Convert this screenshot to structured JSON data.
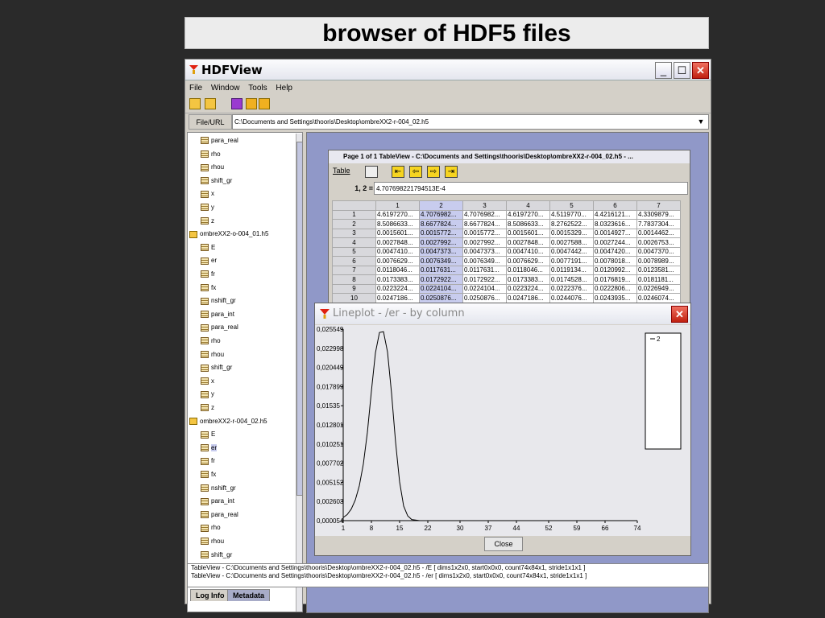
{
  "slide": {
    "title": "browser of HDF5 files"
  },
  "app": {
    "title": "HDFView",
    "menu": [
      "File",
      "Window",
      "Tools",
      "Help"
    ],
    "url_label": "File/URL",
    "url_value": "C:\\Documents and Settings\\thooris\\Desktop\\ombreXX2-r-004_02.h5"
  },
  "tree": [
    {
      "label": "para_real",
      "type": "dataset"
    },
    {
      "label": "rho",
      "type": "dataset"
    },
    {
      "label": "rhou",
      "type": "dataset"
    },
    {
      "label": "shift_gr",
      "type": "dataset"
    },
    {
      "label": "x",
      "type": "dataset"
    },
    {
      "label": "y",
      "type": "dataset"
    },
    {
      "label": "z",
      "type": "dataset"
    },
    {
      "label": "ombreXX2-o-004_01.h5",
      "type": "file"
    },
    {
      "label": "E",
      "type": "dataset"
    },
    {
      "label": "er",
      "type": "dataset"
    },
    {
      "label": "fr",
      "type": "dataset"
    },
    {
      "label": "fx",
      "type": "dataset"
    },
    {
      "label": "nshift_gr",
      "type": "dataset"
    },
    {
      "label": "para_int",
      "type": "dataset"
    },
    {
      "label": "para_real",
      "type": "dataset"
    },
    {
      "label": "rho",
      "type": "dataset"
    },
    {
      "label": "rhou",
      "type": "dataset"
    },
    {
      "label": "shift_gr",
      "type": "dataset"
    },
    {
      "label": "x",
      "type": "dataset"
    },
    {
      "label": "y",
      "type": "dataset"
    },
    {
      "label": "z",
      "type": "dataset"
    },
    {
      "label": "ombreXX2-r-004_02.h5",
      "type": "file"
    },
    {
      "label": "E",
      "type": "dataset"
    },
    {
      "label": "er",
      "type": "dataset",
      "selected": true
    },
    {
      "label": "fr",
      "type": "dataset"
    },
    {
      "label": "fx",
      "type": "dataset"
    },
    {
      "label": "nshift_gr",
      "type": "dataset"
    },
    {
      "label": "para_int",
      "type": "dataset"
    },
    {
      "label": "para_real",
      "type": "dataset"
    },
    {
      "label": "rho",
      "type": "dataset"
    },
    {
      "label": "rhou",
      "type": "dataset"
    },
    {
      "label": "shift_gr",
      "type": "dataset"
    }
  ],
  "tableview": {
    "title": "Page 1 of 1   TableView - C:\\Documents and Settings\\thooris\\Desktop\\ombreXX2-r-004_02.h5 - ...",
    "menu_label": "Table",
    "cell_ref": "1, 2 =",
    "cell_value": "4.707698221794513E-4",
    "columns": [
      "1",
      "2",
      "3",
      "4",
      "5",
      "6",
      "7"
    ],
    "rows": [
      {
        "id": "1",
        "cells": [
          "4.6197270...",
          "4.7076982...",
          "4.7076982...",
          "4.6197270...",
          "4.5119770...",
          "4.4216121...",
          "4.3309879..."
        ]
      },
      {
        "id": "2",
        "cells": [
          "8.5086633...",
          "8.6677824...",
          "8.6677824...",
          "8.5086633...",
          "8.2762522...",
          "8.0323616...",
          "7.7837304..."
        ]
      },
      {
        "id": "3",
        "cells": [
          "0.0015601...",
          "0.0015772...",
          "0.0015772...",
          "0.0015601...",
          "0.0015329...",
          "0.0014927...",
          "0.0014462..."
        ]
      },
      {
        "id": "4",
        "cells": [
          "0.0027848...",
          "0.0027992...",
          "0.0027992...",
          "0.0027848...",
          "0.0027588...",
          "0.0027244...",
          "0.0026753..."
        ]
      },
      {
        "id": "5",
        "cells": [
          "0.0047410...",
          "0.0047373...",
          "0.0047373...",
          "0.0047410...",
          "0.0047442...",
          "0.0047420...",
          "0.0047370..."
        ]
      },
      {
        "id": "6",
        "cells": [
          "0.0076629...",
          "0.0076349...",
          "0.0076349...",
          "0.0076629...",
          "0.0077191...",
          "0.0078018...",
          "0.0078989..."
        ]
      },
      {
        "id": "7",
        "cells": [
          "0.0118046...",
          "0.0117631...",
          "0.0117631...",
          "0.0118046...",
          "0.0119134...",
          "0.0120992...",
          "0.0123581..."
        ]
      },
      {
        "id": "8",
        "cells": [
          "0.0173383...",
          "0.0172922...",
          "0.0172922...",
          "0.0173383...",
          "0.0174528...",
          "0.0176819...",
          "0.0181181..."
        ]
      },
      {
        "id": "9",
        "cells": [
          "0.0223224...",
          "0.0224104...",
          "0.0224104...",
          "0.0223224...",
          "0.0222376...",
          "0.0222806...",
          "0.0226949..."
        ]
      },
      {
        "id": "10",
        "cells": [
          "0.0247186...",
          "0.0250876...",
          "0.0250876...",
          "0.0247186...",
          "0.0244076...",
          "0.0243935...",
          "0.0246074..."
        ]
      }
    ]
  },
  "lineplot": {
    "title": "Lineplot - /er - by column",
    "close_label": "Close"
  },
  "chart_data": {
    "type": "line",
    "title": "",
    "xlabel": "",
    "ylabel": "",
    "xlim": [
      1,
      74
    ],
    "ylim": [
      5.4e-05,
      0.025549
    ],
    "x_ticks": [
      "1",
      "8",
      "15",
      "22",
      "30",
      "37",
      "44",
      "52",
      "59",
      "66",
      "74"
    ],
    "y_ticks": [
      "0,025549",
      "0,022998",
      "0,020449",
      "0,017899",
      "0,01535",
      "0,012801",
      "0,010251",
      "0,007702",
      "0,005152",
      "0,002603",
      "0,000054"
    ],
    "legend": [
      "2"
    ],
    "legend_position": "top-right",
    "grid": false,
    "series": [
      {
        "name": "2",
        "x": [
          1,
          2,
          3,
          4,
          5,
          6,
          7,
          8,
          9,
          10,
          11,
          12,
          13,
          14,
          15,
          16,
          17,
          18,
          20,
          25,
          30,
          40,
          50,
          60,
          74
        ],
        "values": [
          0.00047,
          0.00087,
          0.0016,
          0.0028,
          0.0047,
          0.0076,
          0.0118,
          0.0173,
          0.0224,
          0.0251,
          0.0252,
          0.0225,
          0.017,
          0.0105,
          0.0052,
          0.002,
          0.0007,
          0.0002,
          5.4e-05,
          5.4e-05,
          5.4e-05,
          5.4e-05,
          5.4e-05,
          5.4e-05,
          5.4e-05
        ]
      }
    ]
  },
  "log": {
    "lines": [
      "TableView - C:\\Documents and Settings\\thooris\\Desktop\\ombreXX2-r-004_02.h5 - /E [ dims1x2x0, start0x0x0, count74x84x1, stride1x1x1 ]",
      "TableView - C:\\Documents and Settings\\thooris\\Desktop\\ombreXX2-r-004_02.h5 - /er [ dims1x2x0, start0x0x0, count74x84x1, stride1x1x1 ]"
    ],
    "tabs": [
      "Log Info",
      "Metadata"
    ]
  }
}
